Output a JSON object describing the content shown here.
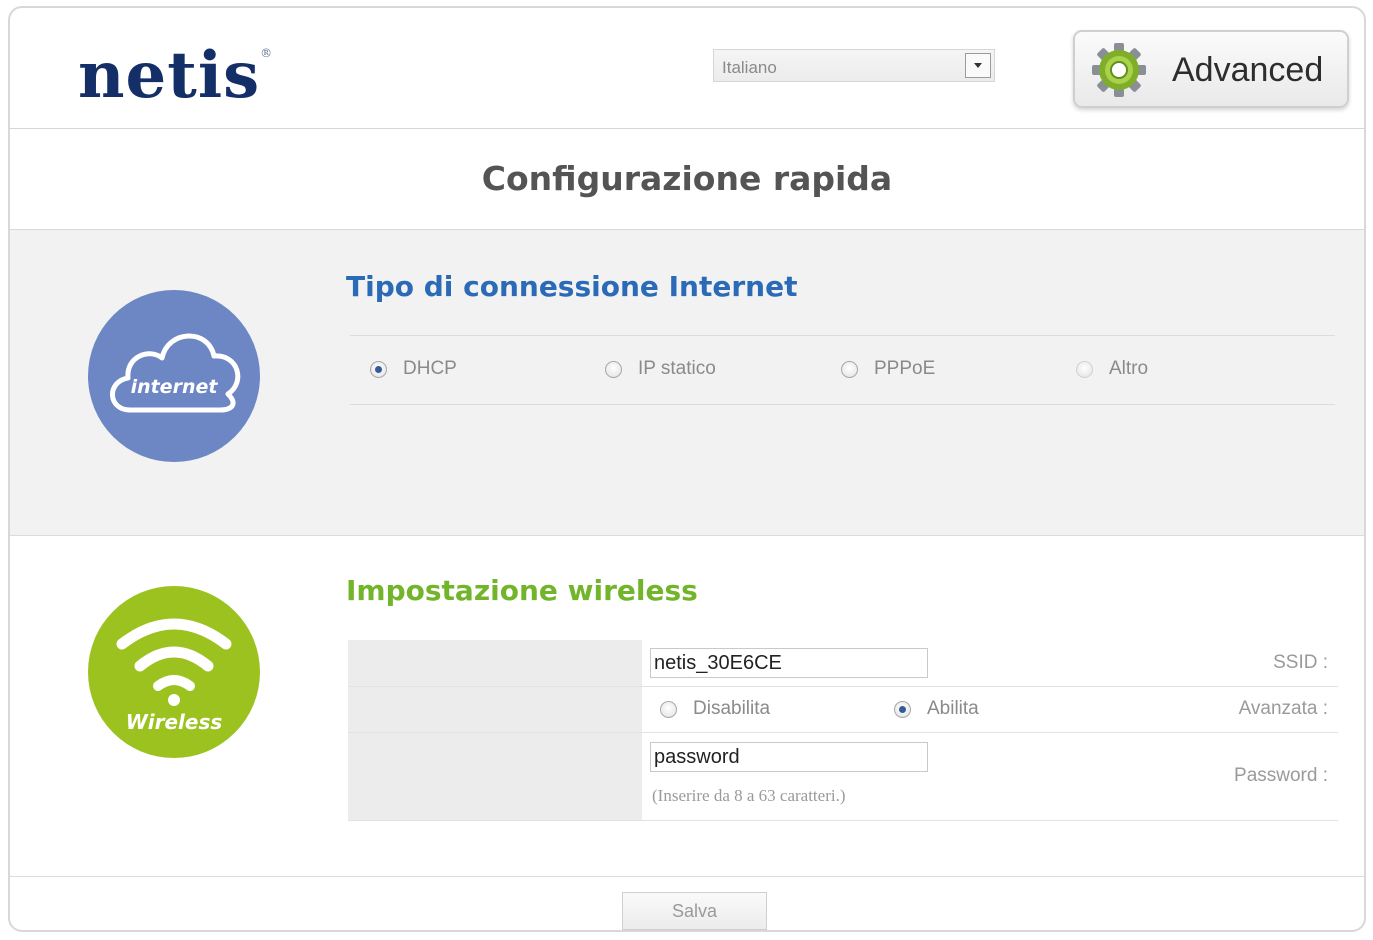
{
  "header": {
    "logo_text": "netis",
    "logo_mark": "®",
    "language": {
      "selected": "Italiano"
    },
    "advanced_label": "Advanced",
    "advanced_icon": "gear-icon"
  },
  "page_title": "Configurazione rapida",
  "internet": {
    "icon": "internet-cloud-icon",
    "icon_text": "internet",
    "heading": "Tipo di connessione Internet",
    "options": [
      {
        "label": "DHCP",
        "checked": true
      },
      {
        "label": "IP statico",
        "checked": false
      },
      {
        "label": "PPPoE",
        "checked": false
      },
      {
        "label": "Altro",
        "checked": false
      }
    ]
  },
  "wireless": {
    "icon": "wireless-wifi-icon",
    "icon_text": "Wireless",
    "heading": "Impostazione wireless",
    "ssid_label": "SSID :",
    "ssid_value": "netis_30E6CE",
    "advanced_label": "Avanzata :",
    "advanced_options": [
      {
        "label": "Disabilita",
        "checked": false
      },
      {
        "label": "Abilita",
        "checked": true
      }
    ],
    "password_label": "Password :",
    "password_value": "password",
    "password_hint": "(Inserire da 8 a 63 caratteri.)"
  },
  "footer": {
    "save_label": "Salva"
  },
  "colors": {
    "logo": "#142f68",
    "internet_heading": "#2a6ab6",
    "wireless_heading": "#73b52a",
    "internet_circle": "#6d86c4",
    "wireless_circle": "#9cc21f"
  }
}
